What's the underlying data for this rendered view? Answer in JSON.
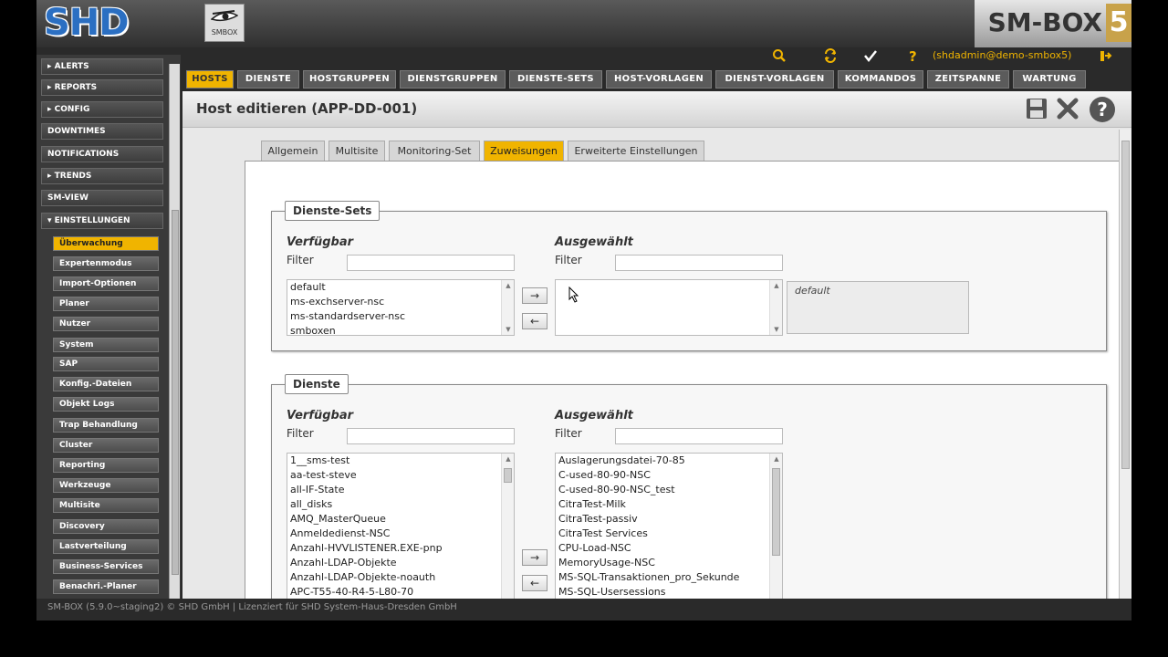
{
  "header": {
    "logo_text": "SHD",
    "small_logo_text": "SMBOX",
    "brand_text": "SM-BOX",
    "brand_number": "5"
  },
  "toolbar": {
    "icons": [
      "search-icon",
      "refresh-icon",
      "check-icon",
      "help-icon",
      "logout-icon"
    ],
    "user": "(shdadmin@demo-smbox5)"
  },
  "nav": {
    "tabs": [
      "HOSTS",
      "DIENSTE",
      "HOSTGRUPPEN",
      "DIENSTGRUPPEN",
      "DIENSTE-SETS",
      "HOST-VORLAGEN",
      "DIENST-VORLAGEN",
      "KOMMANDOS",
      "ZEITSPANNE",
      "WARTUNG"
    ],
    "active": "HOSTS"
  },
  "sidebar": {
    "items": [
      "ALERTS",
      "REPORTS",
      "CONFIG",
      "DOWNTIMES",
      "NOTIFICATIONS",
      "TRENDS",
      "SM-VIEW",
      "EINSTELLUNGEN"
    ],
    "subitems": [
      "Überwachung",
      "Expertenmodus",
      "Import-Optionen",
      "Planer",
      "Nutzer",
      "System",
      "SAP",
      "Konfig.-Dateien",
      "Objekt Logs",
      "Trap Behandlung",
      "Cluster",
      "Reporting",
      "Werkzeuge",
      "Multisite",
      "Discovery",
      "Lastverteilung",
      "Business-Services",
      "Benachri.-Planer"
    ],
    "active_subitem": "Überwachung"
  },
  "page": {
    "title": "Host editieren (APP-DD-001)",
    "subtabs": [
      "Allgemein",
      "Multisite",
      "Monitoring-Set",
      "Zuweisungen",
      "Erweiterte Einstellungen"
    ],
    "active_subtab": "Zuweisungen"
  },
  "dienste_sets": {
    "legend": "Dienste-Sets",
    "available_label": "Verfügbar",
    "selected_label": "Ausgewählt",
    "filter_label": "Filter",
    "available": [
      "default",
      "ms-exchserver-nsc",
      "ms-standardserver-nsc",
      "smboxen"
    ],
    "selected": [],
    "preview": "default"
  },
  "dienste": {
    "legend": "Dienste",
    "available_label": "Verfügbar",
    "selected_label": "Ausgewählt",
    "filter_label": "Filter",
    "available": [
      "1__sms-test",
      "aa-test-steve",
      "all-IF-State",
      "all_disks",
      "AMQ_MasterQueue",
      "Anmeldedienst-NSC",
      "Anzahl-HVVLISTENER.EXE-pnp",
      "Anzahl-LDAP-Objekte",
      "Anzahl-LDAP-Objekte-noauth",
      "APC-T55-40-R4-5-L80-70"
    ],
    "selected": [
      "Auslagerungsdatei-70-85",
      "C-used-80-90-NSC",
      "C-used-80-90-NSC_test",
      "CitraTest-Milk",
      "CitraTest-passiv",
      "CitraTest Services",
      "CPU-Load-NSC",
      "MemoryUsage-NSC",
      "MS-SQL-Transaktionen_pro_Sekunde",
      "MS-SQL-Usersessions"
    ]
  },
  "buttons": {
    "add": "→",
    "remove": "←"
  },
  "footer": "SM-BOX (5.9.0~staging2) © SHD GmbH | Lizenziert für SHD System-Haus-Dresden GmbH",
  "colors": {
    "accent": "#f0b400",
    "brand_blue": "#2b6fc2"
  }
}
